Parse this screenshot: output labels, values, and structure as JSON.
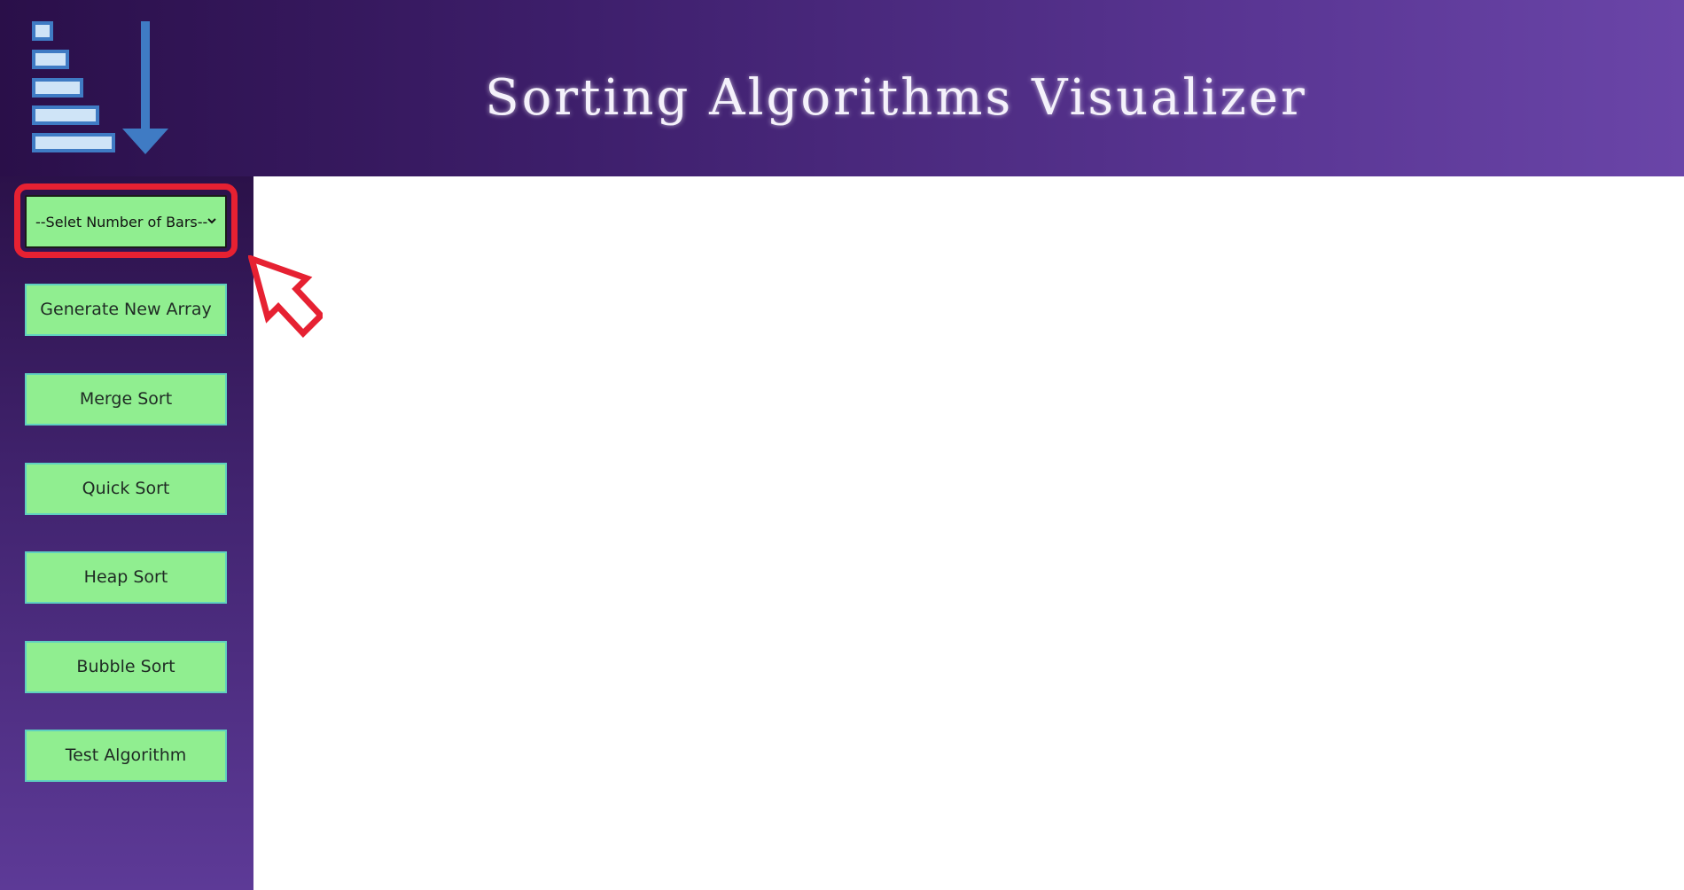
{
  "app": {
    "title": "Sorting Algorithms Visualizer"
  },
  "header": {
    "logo_icon": "sort-descending-icon"
  },
  "sidebar": {
    "bars_select": {
      "selected_label": "--Selet Number of Bars--",
      "icon": "chevron-down-icon"
    },
    "buttons": [
      {
        "label": "Generate New Array"
      },
      {
        "label": "Merge Sort"
      },
      {
        "label": "Quick Sort"
      },
      {
        "label": "Heap Sort"
      },
      {
        "label": "Bubble Sort"
      },
      {
        "label": "Test Algorithm"
      }
    ]
  },
  "annotation": {
    "highlight_color": "#e62132",
    "arrow_icon": "pointer-arrow-icon"
  },
  "colors": {
    "button_bg": "#90ee90",
    "button_border": "#5fd0c0",
    "header_gradient_start": "#2a0f49",
    "header_gradient_end": "#6a45a8"
  }
}
